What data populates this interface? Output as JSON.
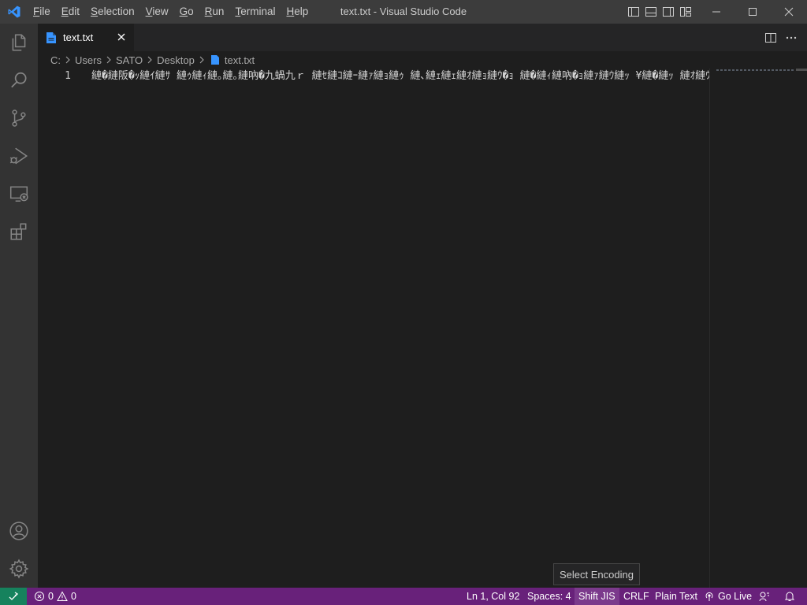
{
  "app": {
    "window_title": "text.txt - Visual Studio Code"
  },
  "menu": [
    {
      "pre": "",
      "u": "F",
      "post": "ile"
    },
    {
      "pre": "",
      "u": "E",
      "post": "dit"
    },
    {
      "pre": "",
      "u": "S",
      "post": "election"
    },
    {
      "pre": "",
      "u": "V",
      "post": "iew"
    },
    {
      "pre": "",
      "u": "G",
      "post": "o"
    },
    {
      "pre": "",
      "u": "R",
      "post": "un"
    },
    {
      "pre": "",
      "u": "T",
      "post": "erminal"
    },
    {
      "pre": "",
      "u": "H",
      "post": "elp"
    }
  ],
  "tab": {
    "label": "text.txt"
  },
  "breadcrumb": [
    "C:",
    "Users",
    "SATO",
    "Desktop",
    "text.txt"
  ],
  "editor": {
    "line_number": "1",
    "line_text": "縺�縺阪�ｯ縺ｲ縺ｻ 縺ｩ縺ｨ縺｡縺｡縺吶�九蝸九ｒ 縺ｾ縺ｺ縺ｰ縺ｧ縺ｮ縺ｩ 縺､縺ｪ縺ｪ縺ｵ縺ｮ縺ｳ�ｮ 縺�縺ｨ縺吶�ｮ縺ｧ縺ｳ縺ｯ ¥縺�縺ｯ 縺ｵ縺ｳ縺｢�ｨ縺ｮ縺ｾ..."
  },
  "tooltip": "Select Encoding",
  "status": {
    "errors": "0",
    "warnings": "0",
    "position": "Ln 1, Col 92",
    "spaces": "Spaces: 4",
    "encoding": "Shift JIS",
    "eol": "CRLF",
    "language": "Plain Text",
    "go_live": "Go Live"
  },
  "colors": {
    "statusbar": "#68217a",
    "remote": "#16825d",
    "titlebar": "#3c3c3c",
    "activitybar": "#333333",
    "editor": "#1e1e1e",
    "accent_icon": "#3794ff"
  },
  "icons": {
    "logo": "vscode-logo-icon",
    "activity": [
      "explorer-icon",
      "search-icon",
      "source-control-icon",
      "run-debug-icon",
      "remote-explorer-icon",
      "extensions-icon",
      "account-icon",
      "settings-gear-icon"
    ]
  }
}
